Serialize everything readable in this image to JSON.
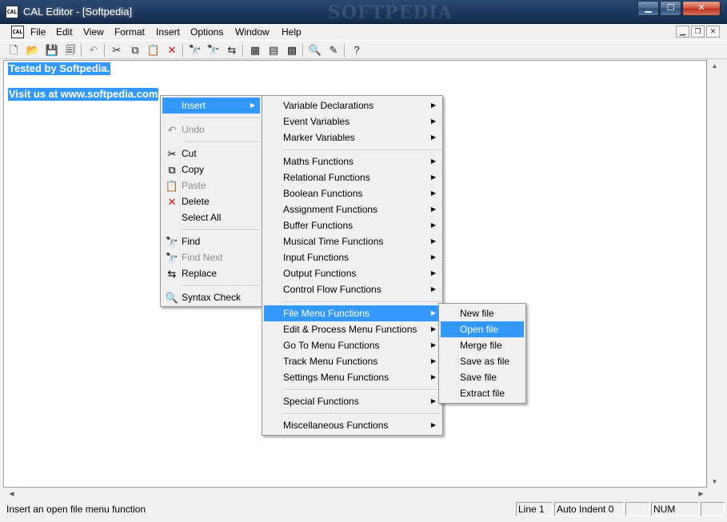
{
  "window": {
    "title": "CAL Editor - [Softpedia]",
    "app_icon_text": "CAL",
    "watermark": "SOFTPEDIA",
    "minimize_icon": "minimize-icon",
    "maximize_icon": "maximize-icon",
    "close_icon": "close-icon"
  },
  "menubar": {
    "items": [
      "File",
      "Edit",
      "View",
      "Format",
      "Insert",
      "Options",
      "Window",
      "Help"
    ]
  },
  "toolbar": {
    "icons": [
      "new-icon",
      "open-icon",
      "save-icon",
      "save-all-icon",
      "undo-icon",
      "cut-icon",
      "copy-icon",
      "paste-icon",
      "delete-icon",
      "find-icon",
      "find-next-icon",
      "replace-icon",
      "insert-var-icon",
      "insert-func-icon",
      "insert-misc-icon",
      "syntax-check-icon",
      "spell-icon",
      "help-icon"
    ]
  },
  "editor": {
    "lines": [
      "Tested by Softpedia.",
      "",
      "Visit us at www.softpedia.com"
    ]
  },
  "context_menu": {
    "items": [
      {
        "label": "Insert",
        "icon": "",
        "submenu": true,
        "highlighted": true
      },
      {
        "label": "Undo",
        "icon": "undo-icon",
        "disabled": true
      },
      {
        "label": "Cut",
        "icon": "cut-icon"
      },
      {
        "label": "Copy",
        "icon": "copy-icon"
      },
      {
        "label": "Paste",
        "icon": "paste-icon",
        "disabled": true
      },
      {
        "label": "Delete",
        "icon": "delete-icon"
      },
      {
        "label": "Select All",
        "icon": ""
      },
      {
        "label": "Find",
        "icon": "find-icon"
      },
      {
        "label": "Find Next",
        "icon": "find-next-icon",
        "disabled": true
      },
      {
        "label": "Replace",
        "icon": "replace-icon"
      },
      {
        "label": "Syntax Check",
        "icon": "syntax-check-icon"
      }
    ]
  },
  "insert_menu": {
    "items": [
      "Variable Declarations",
      "Event Variables",
      "Marker Variables",
      "Maths Functions",
      "Relational Functions",
      "Boolean Functions",
      "Assignment Functions",
      "Buffer Functions",
      "Musical Time Functions",
      "Input Functions",
      "Output Functions",
      "Control Flow Functions",
      "File Menu Functions",
      "Edit & Process Menu Functions",
      "Go To Menu Functions",
      "Track Menu Functions",
      "Settings Menu Functions",
      "Special Functions",
      "Miscellaneous Functions"
    ],
    "highlighted": "File Menu Functions"
  },
  "file_menu_functions": {
    "items": [
      "New file",
      "Open file",
      "Merge file",
      "Save as file",
      "Save file",
      "Extract file"
    ],
    "highlighted": "Open file"
  },
  "statusbar": {
    "message": "Insert an open file menu function",
    "line": "Line 1",
    "auto_indent": "Auto Indent 0",
    "blank": "",
    "num": "NUM"
  },
  "colors": {
    "selection": "#3399ff",
    "titlebar": "#1f3a60",
    "delete_red": "#e01010"
  }
}
